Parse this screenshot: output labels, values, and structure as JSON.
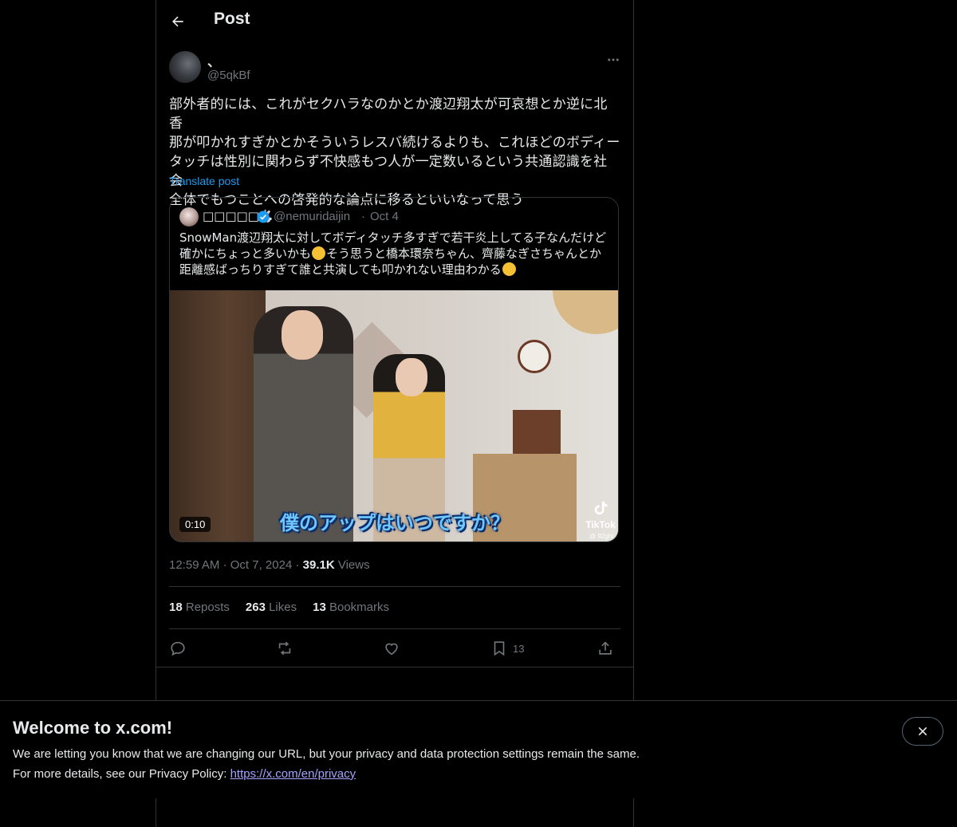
{
  "header": {
    "title": "Post"
  },
  "post": {
    "display_name": "、",
    "handle": "@5qkBf",
    "text": "部外者的には、これがセクハラなのかとか渡辺翔太が可哀想とか逆に北香\n那が叩かれすぎかとかそういうレスバ続けるよりも、これほどのボディー\nタッチは性別に関わらず不快感もつ人が一定数いるという共通認識を社会\n全体でもつことへの啓発的な論点に移るといいなって思う",
    "translate_label": "Translate post",
    "time": "12:59 AM",
    "date": "Oct 7, 2024",
    "views_count": "39.1K",
    "views_label": "Views",
    "reposts_count": "18",
    "reposts_label": "Reposts",
    "likes_count": "263",
    "likes_label": "Likes",
    "bookmarks_count": "13",
    "bookmarks_label": "Bookmarks",
    "bookmark_action_count": "13"
  },
  "quote": {
    "display_name": "□□□□□🐇",
    "handle": "@nemuridaijin",
    "dot": "·",
    "date": "Oct 4",
    "text_line1": "SnowMan渡辺翔太に対してボディタッチ多すぎで若干炎上してる子なんだけど",
    "text_line2a": "確かにちょっと多いかも",
    "text_line2b": "そう思うと橋本環奈ちゃん、齊藤なぎさちゃんとか",
    "text_line3": "距離感ばっちりすぎて誰と共演しても叩かれない理由わかる",
    "video_caption": "僕のアップはいつですか？",
    "video_duration": "0:10",
    "watermark_brand": "TikTok",
    "watermark_handle": "@ 92ghi"
  },
  "banner": {
    "title": "Welcome to x.com!",
    "line1": "We are letting you know that we are changing our URL, but your privacy and data protection settings remain the same.",
    "line2_prefix": "For more details, see our Privacy Policy: ",
    "link": "https://x.com/en/privacy"
  },
  "colors": {
    "accent": "#1d9bf0",
    "muted": "#71767b",
    "border": "#2f3336",
    "background": "#000000"
  },
  "icons": [
    "back-arrow-icon",
    "more-icon",
    "verified-icon",
    "reply-icon",
    "repost-icon",
    "like-icon",
    "bookmark-icon",
    "share-icon",
    "close-icon",
    "tiktok-icon"
  ]
}
